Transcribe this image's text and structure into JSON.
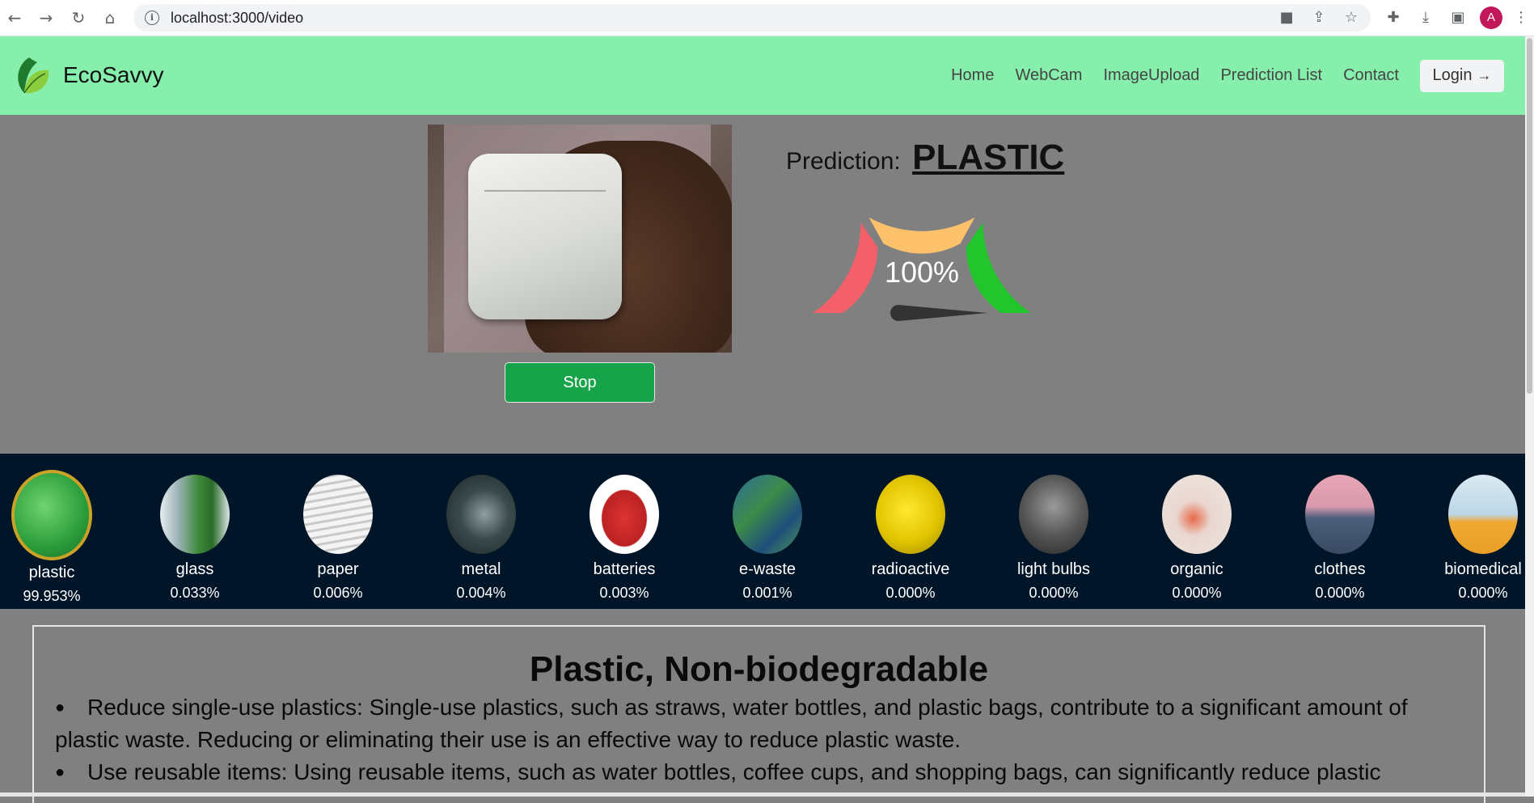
{
  "browser": {
    "url": "localhost:3000/video",
    "profile_initial": "A"
  },
  "navbar": {
    "brand": "EcoSavvy",
    "links": [
      "Home",
      "WebCam",
      "ImageUpload",
      "Prediction List",
      "Contact"
    ],
    "login_label": "Login",
    "background": "#86efac"
  },
  "video": {
    "stop_label": "Stop"
  },
  "prediction": {
    "label": "Prediction:",
    "value": "PLASTIC",
    "percent": "100%",
    "gauge_level": 1.0,
    "gauge_colors": [
      "#f3606a",
      "#fdc06b",
      "#22c52b"
    ]
  },
  "categories": [
    {
      "name": "plastic",
      "pct": "99.953%",
      "active": true
    },
    {
      "name": "glass",
      "pct": "0.033%"
    },
    {
      "name": "paper",
      "pct": "0.006%"
    },
    {
      "name": "metal",
      "pct": "0.004%"
    },
    {
      "name": "batteries",
      "pct": "0.003%"
    },
    {
      "name": "e-waste",
      "pct": "0.001%"
    },
    {
      "name": "radioactive",
      "pct": "0.000%"
    },
    {
      "name": "light bulbs",
      "pct": "0.000%"
    },
    {
      "name": "organic",
      "pct": "0.000%"
    },
    {
      "name": "clothes",
      "pct": "0.000%"
    },
    {
      "name": "biomedical",
      "pct": "0.000%"
    }
  ],
  "info": {
    "title": "Plastic, Non-biodegradable",
    "tips": [
      "Reduce single-use plastics: Single-use plastics, such as straws, water bottles, and plastic bags, contribute to a significant amount of plastic waste. Reducing or eliminating their use is an effective way to reduce plastic waste.",
      "Use reusable items: Using reusable items, such as water bottles, coffee cups, and shopping bags, can significantly reduce plastic"
    ]
  }
}
